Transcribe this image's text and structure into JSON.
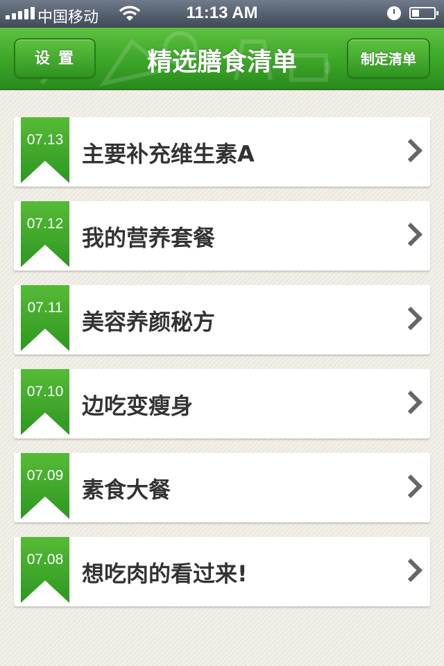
{
  "status_bar": {
    "carrier": "中国移动",
    "time": "11:13 AM"
  },
  "nav": {
    "settings_label": "设置",
    "title": "精选膳食清单",
    "make_list_label": "制定清单"
  },
  "items": [
    {
      "date": "07.13",
      "title": "主要补充维生素A"
    },
    {
      "date": "07.12",
      "title": "我的营养套餐"
    },
    {
      "date": "07.11",
      "title": "美容养颜秘方"
    },
    {
      "date": "07.10",
      "title": "边吃变瘦身"
    },
    {
      "date": "07.09",
      "title": "素食大餐"
    },
    {
      "date": "07.08",
      "title": "想吃肉的看过来!"
    }
  ],
  "colors": {
    "accent": "#3ea82a",
    "ribbon": "#3aa82a",
    "background": "#efece4"
  }
}
